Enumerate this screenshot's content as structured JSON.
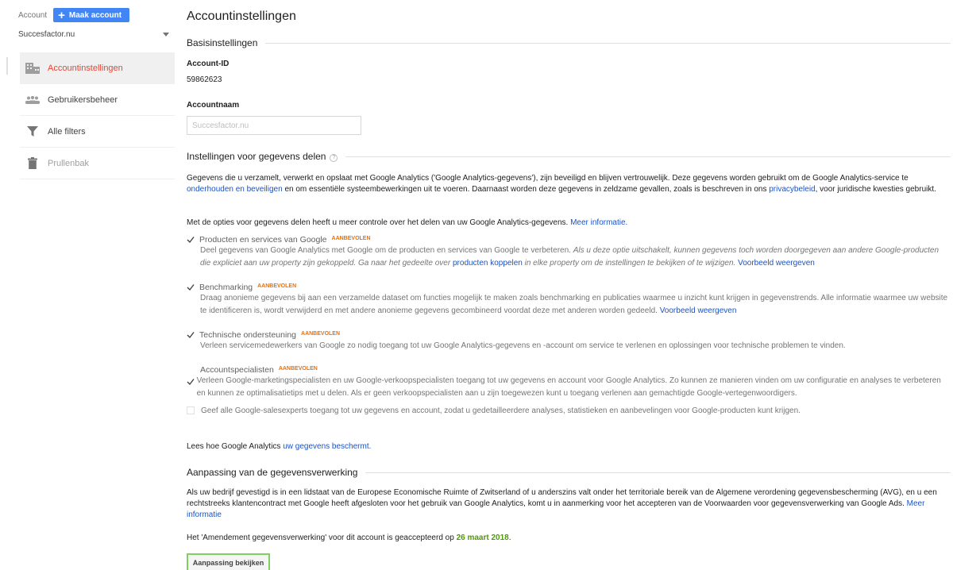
{
  "sidebar": {
    "account_label": "Account",
    "create_button": "Maak account",
    "account_select": "Succesfactor.nu",
    "items": [
      {
        "label": "Accountinstellingen",
        "icon": "building-icon"
      },
      {
        "label": "Gebruikersbeheer",
        "icon": "users-icon"
      },
      {
        "label": "Alle filters",
        "icon": "filter-icon"
      },
      {
        "label": "Prullenbak",
        "icon": "trash-icon"
      }
    ]
  },
  "main": {
    "title": "Accountinstellingen",
    "basic": {
      "heading": "Basisinstellingen",
      "account_id_label": "Account-ID",
      "account_id": "59862623",
      "account_name_label": "Accountnaam",
      "account_name_placeholder": "Succesfactor.nu"
    },
    "sharing": {
      "heading": "Instellingen voor gegevens delen",
      "help": "?",
      "intro_1": "Gegevens die u verzamelt, verwerkt en opslaat met Google Analytics ('Google Analytics-gegevens'), zijn beveiligd en blijven vertrouwelijk. Deze gegevens worden gebruikt om de Google Analytics-service te ",
      "intro_link_1": "onderhouden en beveiligen",
      "intro_2": " en om essentiële systeembewerkingen uit te voeren. Daarnaast worden deze gegevens in zeldzame gevallen, zoals is beschreven in ons ",
      "intro_link_2": "privacybeleid",
      "intro_3": ", voor juridische kwesties gebruikt.",
      "options_intro": "Met de opties voor gegevens delen heeft u meer controle over het delen van uw Google Analytics-gegevens. ",
      "options_intro_link": "Meer informatie.",
      "recommended": "AANBEVOLEN",
      "opt1": {
        "title": "Producten en services van Google",
        "desc": "Deel gegevens van Google Analytics met Google om de producten en services van Google te verbeteren. ",
        "desc_italic_1": "Als u deze optie uitschakelt, kunnen gegevens toch worden doorgegeven aan andere Google-producten die expliciet aan uw property zijn gekoppeld. Ga naar het gedeelte over ",
        "desc_link": "producten koppelen",
        "desc_italic_2": " in elke property om de instellingen te bekijken of te wijzigen.",
        "example_link": "Voorbeeld weergeven"
      },
      "opt2": {
        "title": "Benchmarking",
        "desc": "Draag anonieme gegevens bij aan een verzamelde dataset om functies mogelijk te maken zoals benchmarking en publicaties waarmee u inzicht kunt krijgen in gegevenstrends. Alle informatie waarmee uw website te identificeren is, wordt verwijderd en met andere anonieme gegevens gecombineerd voordat deze met anderen worden gedeeld. ",
        "example_link": "Voorbeeld weergeven"
      },
      "opt3": {
        "title": "Technische ondersteuning",
        "desc": "Verleen servicemedewerkers van Google zo nodig toegang tot uw Google Analytics-gegevens en -account om service te verlenen en oplossingen voor technische problemen te vinden."
      },
      "opt4": {
        "title": "Accountspecialisten",
        "desc": "Verleen Google-marketingspecialisten en uw Google-verkoopspecialisten toegang tot uw gegevens en account voor Google Analytics. Zo kunnen ze manieren vinden om uw configuratie en analyses te verbeteren en kunnen ze optimalisatietips met u delen. Als er geen verkoopspecialisten aan u zijn toegewezen kunt u toegang verlenen aan gemachtigde Google-vertegenwoordigers.",
        "sub_option": "Geef alle Google-salesexperts toegang tot uw gegevens en account, zodat u gedetailleerdere analyses, statistieken en aanbevelingen voor Google-producten kunt krijgen."
      },
      "protect_text": "Lees hoe Google Analytics ",
      "protect_link": "uw gegevens beschermt."
    },
    "processing": {
      "heading": "Aanpassing van de gegevensverwerking",
      "text": "Als uw bedrijf gevestigd is in een lidstaat van de Europese Economische Ruimte of Zwitserland of u anderszins valt onder het territoriale bereik van de Algemene verordening gegevensbescherming (AVG), en u een rechtstreeks klantencontract met Google heeft afgesloten voor het gebruik van Google Analytics, komt u in aanmerking voor het accepteren van de Voorwaarden voor gegevensverwerking van Google Ads. ",
      "text_link": "Meer informatie",
      "accepted_text": "Het 'Amendement gegevensverwerking' voor dit account is geaccepteerd op ",
      "accepted_date": "26 maart 2018",
      "accepted_end": ".",
      "button": "Aanpassing bekijken"
    }
  }
}
